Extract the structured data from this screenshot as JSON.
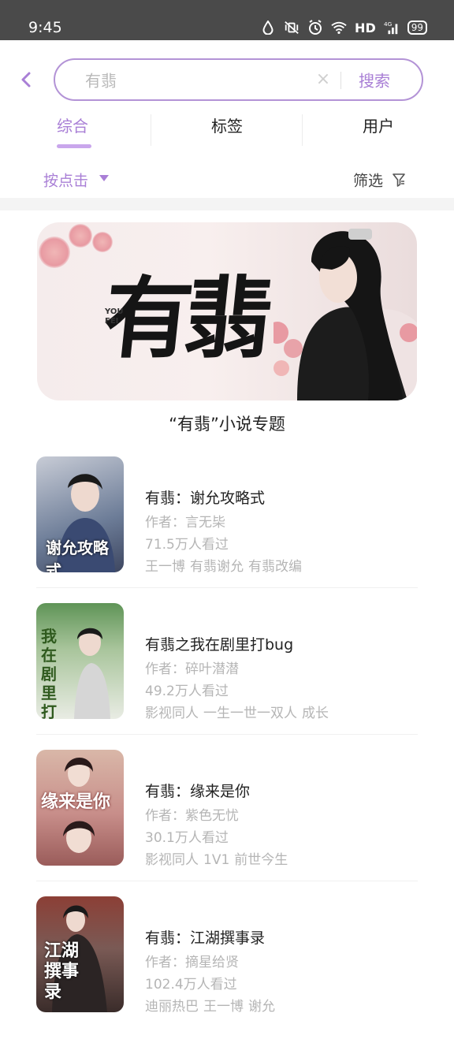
{
  "status_bar": {
    "time": "9:45",
    "network": "HD",
    "signal": "4G",
    "battery": "99"
  },
  "search": {
    "query": "有翡",
    "button": "搜索"
  },
  "tabs": [
    {
      "label": "综合"
    },
    {
      "label": "标签"
    },
    {
      "label": "用户"
    }
  ],
  "filters": {
    "sort": "按点击",
    "filter": "筛选"
  },
  "banner": {
    "calligraphy": "有翡",
    "english_line1": "YOU",
    "english_line2": "FEI",
    "caption": "“有翡”小说专题"
  },
  "books": [
    {
      "title": "有翡：谢允攻略式",
      "author": "作者：言无枈",
      "views": "71.5万人看过",
      "tags": [
        "王一博",
        "有翡谢允",
        "有翡改编"
      ],
      "cover_text": "谢允攻略式",
      "cover_color": "#6d7d98"
    },
    {
      "title": "有翡之我在剧里打bug",
      "author": "作者：碎叶潜潜",
      "views": "49.2万人看过",
      "tags": [
        "影视同人",
        "一生一世一双人",
        "成长"
      ],
      "cover_text": "我在剧里打bug",
      "cover_color": "#7ea06a"
    },
    {
      "title": "有翡：缘来是你",
      "author": "作者：紫色无忧",
      "views": "30.1万人看过",
      "tags": [
        "影视同人",
        "1V1",
        "前世今生"
      ],
      "cover_text": "缘来是你",
      "cover_color": "#c88e8a"
    },
    {
      "title": "有翡：江湖撰事录",
      "author": "作者：摘星给贤",
      "views": "102.4万人看过",
      "tags": [
        "迪丽热巴",
        "王一博",
        "谢允"
      ],
      "cover_text": "江湖撰事录",
      "cover_color": "#7a5a55"
    }
  ],
  "colors": {
    "accent": "#a97fd6",
    "search_border": "#b393d6",
    "muted": "#b5b5b5",
    "status_bar": "#4a4a4a"
  }
}
